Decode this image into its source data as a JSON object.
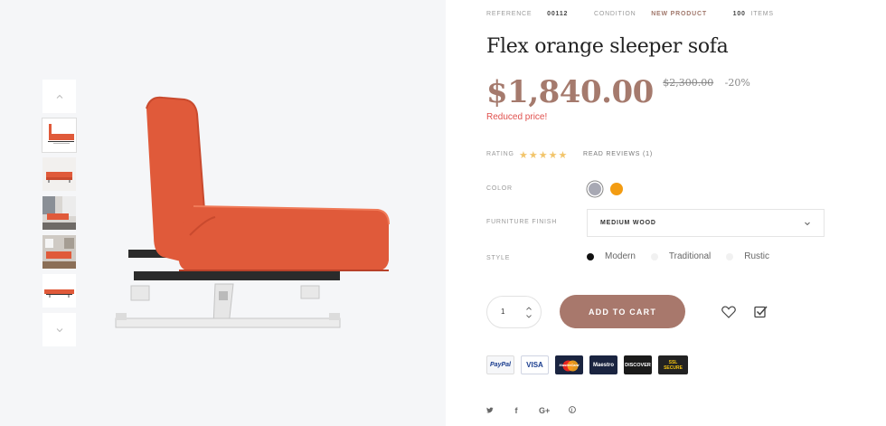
{
  "meta": {
    "reference_label": "REFERENCE",
    "reference_value": "00112",
    "condition_label": "CONDITION",
    "condition_value": "NEW PRODUCT",
    "stock_value": "100",
    "stock_unit": "ITEMS"
  },
  "product": {
    "title": "Flex orange sleeper sofa",
    "price": "$1,840.00",
    "old_price": "$2,300.00",
    "discount": "-20%",
    "reduced_text": "Reduced price!"
  },
  "rating": {
    "label": "RATING",
    "stars": "★★★★★",
    "reviews_link": "READ REVIEWS (1)"
  },
  "color": {
    "label": "COLOR",
    "options": [
      {
        "name": "grey",
        "hex": "#a8a9b4",
        "selected": true
      },
      {
        "name": "orange",
        "hex": "#f39c12",
        "selected": false
      }
    ]
  },
  "finish": {
    "label": "FURNITURE FINISH",
    "selected": "MEDIUM WOOD"
  },
  "style": {
    "label": "STYLE",
    "options": [
      {
        "label": "Modern",
        "selected": true
      },
      {
        "label": "Traditional",
        "selected": false
      },
      {
        "label": "Rustic",
        "selected": false
      }
    ]
  },
  "cart": {
    "quantity": "1",
    "add_label": "ADD TO CART"
  },
  "payments": {
    "paypal": "PayPal",
    "visa": "VISA",
    "mastercard": "MasterCard",
    "maestro": "Maestro",
    "discover": "DISCOVER",
    "ssl_top": "SSL",
    "ssl_bottom": "SECURE"
  },
  "social_icons": [
    "twitter-icon",
    "facebook-icon",
    "google-plus-icon",
    "pinterest-icon"
  ],
  "colors": {
    "accent": "#a8786c",
    "price": "#a57a6d",
    "reduced": "#e0504d",
    "stars": "#f2c56b",
    "sofa": "#e05a3a"
  }
}
